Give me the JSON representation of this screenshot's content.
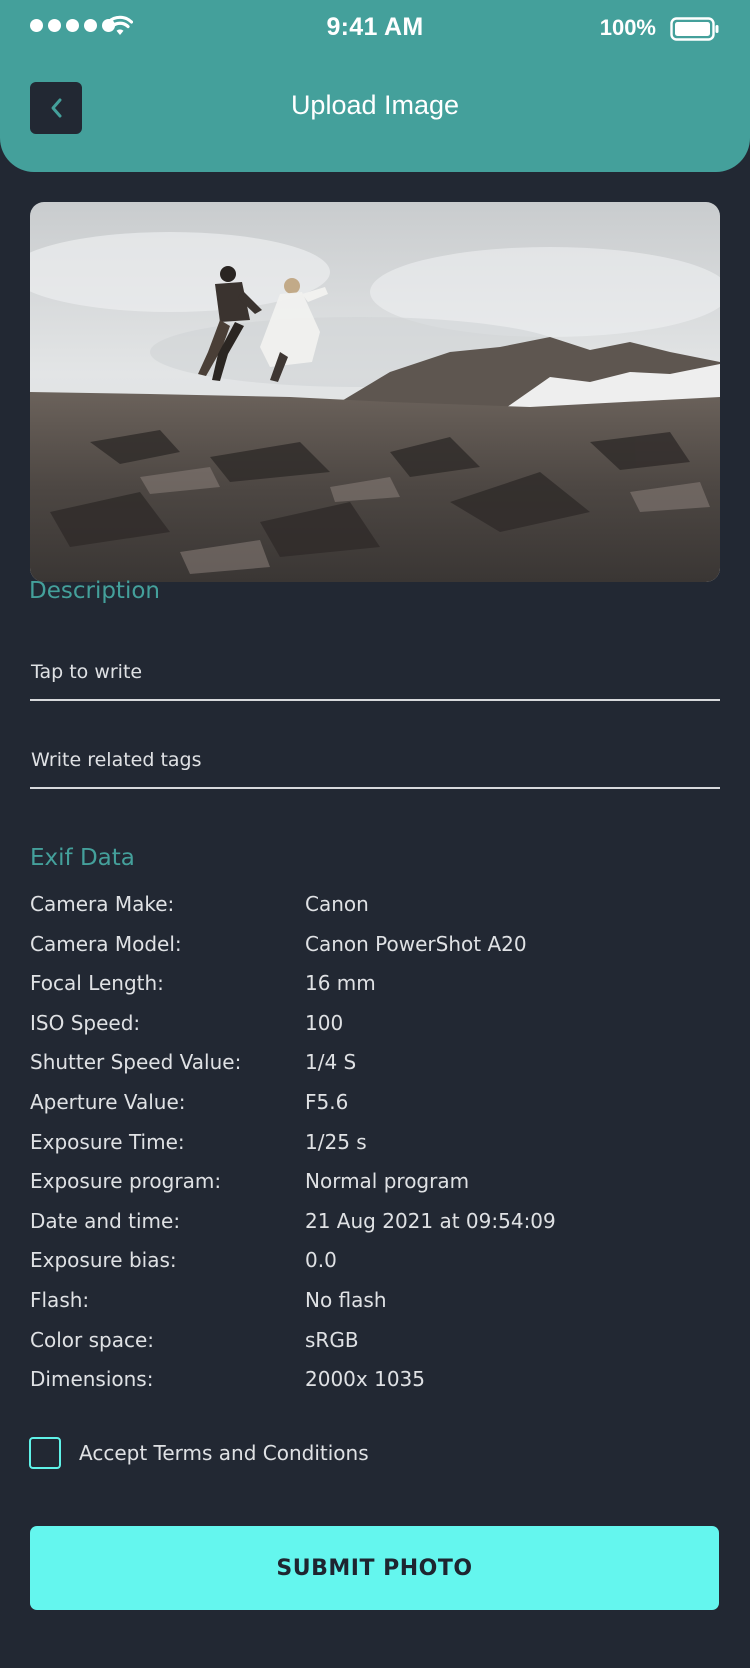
{
  "status_bar": {
    "time": "9:41 AM",
    "battery": "100%",
    "signal_icon": "signal-dots-icon",
    "wifi_icon": "wifi-icon",
    "battery_icon": "battery-icon"
  },
  "header": {
    "title": "Upload Image",
    "back_icon": "chevron-left-icon",
    "background_color": "#44a09b"
  },
  "photo": {
    "subject": "couple running across rocky mountain ridge"
  },
  "description": {
    "heading": "Description",
    "description_placeholder": "Tap to write",
    "tags_placeholder": "Write related tags"
  },
  "exif": {
    "heading": "Exif Data",
    "rows": [
      {
        "label": "Camera Make:",
        "value": "Canon"
      },
      {
        "label": "Camera Model:",
        "value": "Canon PowerShot A20"
      },
      {
        "label": "Focal Length:",
        "value": "16 mm"
      },
      {
        "label": "ISO Speed:",
        "value": "100"
      },
      {
        "label": "Shutter Speed Value:",
        "value": "1/4 S"
      },
      {
        "label": "Aperture Value:",
        "value": "F5.6"
      },
      {
        "label": "Exposure Time:",
        "value": "1/25 s"
      },
      {
        "label": "Exposure program:",
        "value": "Normal program"
      },
      {
        "label": "Date and time:",
        "value": "21 Aug 2021 at 09:54:09"
      },
      {
        "label": "Exposure bias:",
        "value": "0.0"
      },
      {
        "label": "Flash:",
        "value": "No flash"
      },
      {
        "label": "Color space:",
        "value": "sRGB"
      },
      {
        "label": "Dimensions:",
        "value": "2000x 1035"
      }
    ]
  },
  "terms": {
    "label": "Accept Terms and Conditions",
    "checked": false
  },
  "submit": {
    "label": "SUBMIT PHOTO",
    "color": "#64f6ee"
  },
  "colors": {
    "background": "#222833",
    "accent": "#44a09b"
  }
}
